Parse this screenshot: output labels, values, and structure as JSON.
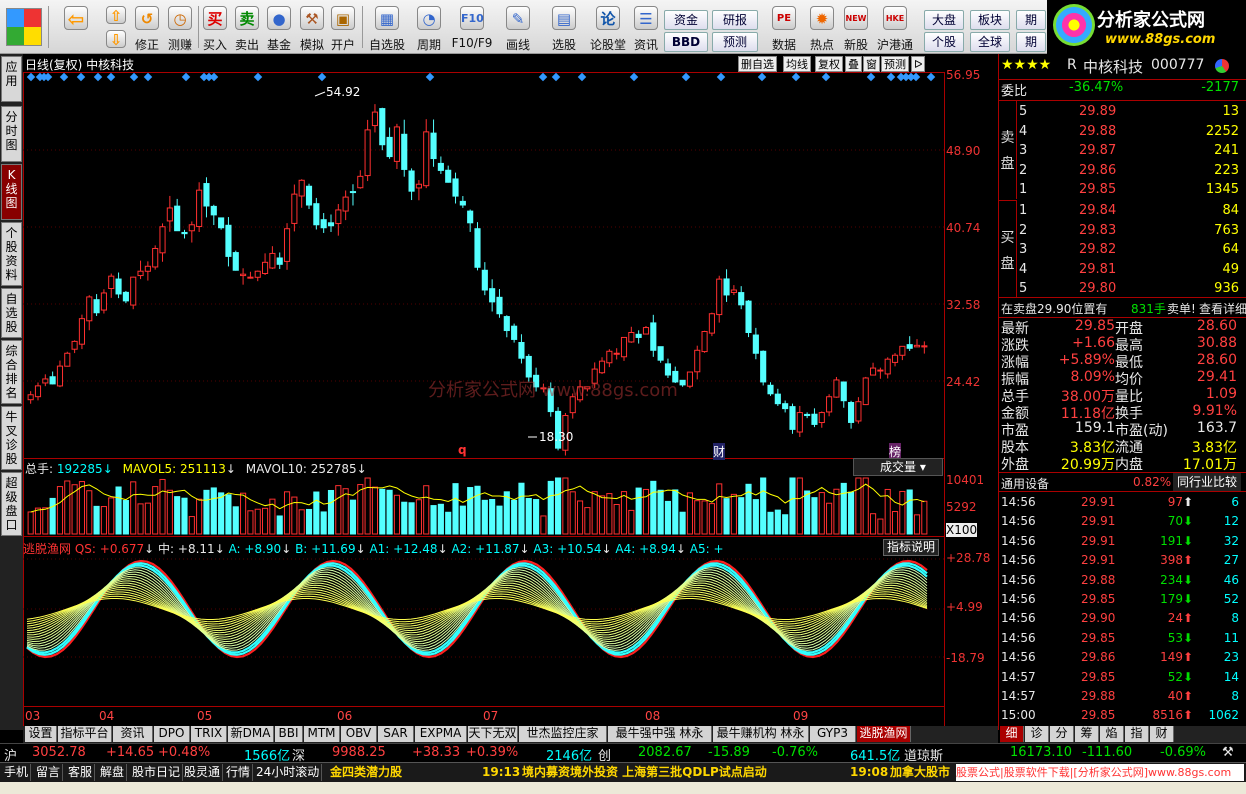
{
  "toolbar": {
    "buttons": [
      {
        "id": "back",
        "label": "",
        "icon": "back-arrow-icon"
      },
      {
        "id": "revise",
        "label": "修正",
        "icon": "revise-icon"
      },
      {
        "id": "test",
        "label": "测赚",
        "icon": "clock-icon"
      },
      {
        "id": "buy",
        "label": "买入",
        "icon": "buy-icon",
        "glyph": "买"
      },
      {
        "id": "sell",
        "label": "卖出",
        "icon": "sell-icon",
        "glyph": "卖"
      },
      {
        "id": "fund",
        "label": "基金",
        "icon": "fund-icon"
      },
      {
        "id": "sim",
        "label": "模拟",
        "icon": "hammer-icon"
      },
      {
        "id": "open",
        "label": "开户",
        "icon": "lock-icon"
      },
      {
        "id": "self",
        "label": "自选股",
        "icon": "selfstock-icon"
      },
      {
        "id": "period",
        "label": "周期",
        "icon": "period-icon"
      },
      {
        "id": "f7f9",
        "label": "F10/F9",
        "icon": "f10-icon"
      },
      {
        "id": "draw",
        "label": "画线",
        "icon": "pen-icon"
      },
      {
        "id": "pick",
        "label": "选股",
        "icon": "pick-icon"
      },
      {
        "id": "forum",
        "label": "论股堂",
        "icon": "forum-icon",
        "glyph": "论"
      },
      {
        "id": "info",
        "label": "资讯",
        "icon": "info-icon"
      },
      {
        "id": "data",
        "label": "数据",
        "icon": "pe-icon",
        "glyph": "PE"
      },
      {
        "id": "hot",
        "label": "热点",
        "icon": "hot-icon"
      },
      {
        "id": "newstock",
        "label": "新股",
        "icon": "newstock-icon",
        "glyph": "NEW"
      },
      {
        "id": "hk",
        "label": "沪港通",
        "icon": "hk-icon",
        "glyph": "HKE"
      }
    ],
    "small": {
      "capital": "资金",
      "bbd": "BBD",
      "research": "研报",
      "forecast": "预测",
      "market": "大盘",
      "sector": "板块",
      "stock": "个股",
      "global": "全球",
      "period_short": "期"
    }
  },
  "logo": {
    "title": "分析家公式网",
    "url": "www.88gs.com"
  },
  "left_tabs": [
    "应用",
    "分时图",
    "K线图",
    "个股资料",
    "自选股",
    "综合排名",
    "牛叉诊股",
    "超级盘口"
  ],
  "chart": {
    "header": "日线(复权)  中核科技",
    "tool_buttons": [
      "删自选",
      "均线",
      "复权",
      "叠",
      "窗",
      "预测",
      "ᐅ"
    ],
    "price_axis": [
      "56.95",
      "48.90",
      "40.74",
      "32.58",
      "24.42"
    ],
    "high_label": "54.92",
    "low_label": "18.30",
    "watermark": "分析家公式网   www.88gs.com",
    "markers": [
      "q",
      "财",
      "榜"
    ],
    "volume": {
      "label_total": "总手:",
      "total": "192285",
      "mavol5_label": "MAVOL5:",
      "mavol5": "251113",
      "mavol10_label": "MAVOL10:",
      "mavol10": "252785",
      "dropdown": "成交量",
      "axis": [
        "10401",
        "5292",
        "X100"
      ]
    },
    "indicator": {
      "name": "逃脱渔网",
      "qs": "QS: +0.677",
      "mid": "中: +8.11",
      "a": "A: +8.90",
      "b": "B: +11.69",
      "a1": "A1: +12.48",
      "a2": "A2: +11.87",
      "a3": "A3: +10.54",
      "a4": "A4: +8.94",
      "a5": "A5: +",
      "explain": "指标说明",
      "axis": [
        "+28.78",
        "+4.99",
        "-18.79"
      ]
    },
    "months": [
      "03",
      "04",
      "05",
      "06",
      "07",
      "08",
      "09"
    ]
  },
  "chart_data": {
    "type": "candlestick",
    "title": "日线(复权) 中核科技",
    "ylim": [
      18.3,
      56.95
    ],
    "closes": [
      24.9,
      25.8,
      26.5,
      26.0,
      27.8,
      29.1,
      30.3,
      32.6,
      34.8,
      33.2,
      35.2,
      36.9,
      35.1,
      34.4,
      36.8,
      37.4,
      37.9,
      39.7,
      41.9,
      43.8,
      41.5,
      41.2,
      42.1,
      45.6,
      44.0,
      43.1,
      41.8,
      38.9,
      37.5,
      37.1,
      36.8,
      37.4,
      38.3,
      39.2,
      38.1,
      41.7,
      45.2,
      46.6,
      44.1,
      42.1,
      41.8,
      42.0,
      43.6,
      44.9,
      45.4,
      47.0,
      51.7,
      53.5,
      50.2,
      49.0,
      52.0,
      47.7,
      45.5,
      46.2,
      51.5,
      48.8,
      47.6,
      46.4,
      45.0,
      44.1,
      42.3,
      37.8,
      35.5,
      34.3,
      33.1,
      31.4,
      30.5,
      28.6,
      26.7,
      25.7,
      25.6,
      23.2,
      19.5,
      22.8,
      24.7,
      25.7,
      25.7,
      27.5,
      28.3,
      29.3,
      29.1,
      30.7,
      31.2,
      30.7,
      31.7,
      29.4,
      28.4,
      26.9,
      26.2,
      25.9,
      27.2,
      29.4,
      31.3,
      33.1,
      36.6,
      35.0,
      35.5,
      34.0,
      31.2,
      29.1,
      26.2,
      25.0,
      24.0,
      23.5,
      21.4,
      23.1,
      22.8,
      21.9,
      23.1,
      24.7,
      26.4,
      24.3,
      22.1,
      24.2,
      26.6,
      27.6,
      27.4,
      28.5,
      28.9,
      29.8,
      29.6,
      29.9,
      29.85
    ],
    "high": 54.92,
    "low": 18.3
  },
  "quote": {
    "stars": "★★★★",
    "r": "R",
    "name": "中核科技",
    "code": "000777",
    "weibi_label": "委比",
    "weibi": "-36.47%",
    "weicha": "-2177",
    "sell_label": [
      "卖",
      "盘"
    ],
    "buy_label": [
      "买",
      "盘"
    ],
    "asks": [
      {
        "n": "5",
        "p": "29.89",
        "v": "13"
      },
      {
        "n": "4",
        "p": "29.88",
        "v": "2252"
      },
      {
        "n": "3",
        "p": "29.87",
        "v": "241"
      },
      {
        "n": "2",
        "p": "29.86",
        "v": "223"
      },
      {
        "n": "1",
        "p": "29.85",
        "v": "1345"
      }
    ],
    "bids": [
      {
        "n": "1",
        "p": "29.84",
        "v": "84"
      },
      {
        "n": "2",
        "p": "29.83",
        "v": "763"
      },
      {
        "n": "3",
        "p": "29.82",
        "v": "64"
      },
      {
        "n": "4",
        "p": "29.81",
        "v": "49"
      },
      {
        "n": "5",
        "p": "29.80",
        "v": "936"
      }
    ],
    "notice": {
      "a": "在卖盘29.90位置有",
      "b": "831手",
      "c": "卖单!",
      "d": "查看详细"
    },
    "stats": [
      {
        "l1": "最新",
        "v1": "29.85",
        "l2": "开盘",
        "v2": "28.60"
      },
      {
        "l1": "涨跌",
        "v1": "+1.66",
        "l2": "最高",
        "v2": "30.88"
      },
      {
        "l1": "涨幅",
        "v1": "+5.89%",
        "l2": "最低",
        "v2": "28.60"
      },
      {
        "l1": "振幅",
        "v1": "8.09%",
        "l2": "均价",
        "v2": "29.41"
      },
      {
        "l1": "总手",
        "v1": "38.00万",
        "l2": "量比",
        "v2": "1.09"
      },
      {
        "l1": "金额",
        "v1": "11.18亿",
        "l2": "换手",
        "v2": "9.91%"
      },
      {
        "l1": "市盈",
        "v1": "159.1",
        "l2": "市盈(动)",
        "v2": "163.7"
      },
      {
        "l1": "股本",
        "v1": "3.83亿",
        "l2": "流通",
        "v2": "3.83亿"
      },
      {
        "l1": "外盘",
        "v1": "20.99万",
        "l2": "内盘",
        "v2": "17.01万"
      }
    ],
    "device": {
      "label": "通用设备",
      "pct": "0.82%",
      "compare": "同行业比较"
    },
    "ticks": [
      {
        "t": "14:56",
        "p": "29.91",
        "v": "97",
        "d": "up",
        "n": "6"
      },
      {
        "t": "14:56",
        "p": "29.91",
        "v": "70",
        "d": "dn",
        "n": "12"
      },
      {
        "t": "14:56",
        "p": "29.91",
        "v": "191",
        "d": "dn",
        "n": "32"
      },
      {
        "t": "14:56",
        "p": "29.91",
        "v": "398",
        "d": "up",
        "n": "27"
      },
      {
        "t": "14:56",
        "p": "29.88",
        "v": "234",
        "d": "dn",
        "n": "46"
      },
      {
        "t": "14:56",
        "p": "29.85",
        "v": "179",
        "d": "dn",
        "n": "52"
      },
      {
        "t": "14:56",
        "p": "29.90",
        "v": "24",
        "d": "up",
        "n": "8"
      },
      {
        "t": "14:56",
        "p": "29.85",
        "v": "53",
        "d": "dn",
        "n": "11"
      },
      {
        "t": "14:56",
        "p": "29.86",
        "v": "149",
        "d": "up",
        "n": "23"
      },
      {
        "t": "14:57",
        "p": "29.85",
        "v": "52",
        "d": "dn",
        "n": "14"
      },
      {
        "t": "14:57",
        "p": "29.88",
        "v": "40",
        "d": "up",
        "n": "8"
      },
      {
        "t": "15:00",
        "p": "29.85",
        "v": "8516",
        "d": "up",
        "n": "1062"
      }
    ]
  },
  "bottom_tabs": [
    "设置",
    "指标平台",
    "资讯",
    "DPO",
    "TRIX",
    "新DMA",
    "BBI",
    "MTM",
    "OBV",
    "SAR",
    "EXPMA",
    "天下无双",
    "世杰监控庄家",
    "最牛强中强 林永",
    "最牛赚机构 林永",
    "GYP3",
    "逃脱渔网"
  ],
  "right_tabs": [
    "细",
    "诊",
    "分",
    "筹",
    "焰",
    "指",
    "财"
  ],
  "index_bar": {
    "sh": "沪",
    "sh_v": "3052.78",
    "sh_c": "+14.65",
    "sh_p": "+0.48%",
    "sh_amt": "1566亿",
    "sz": "深",
    "sz_v": "9988.25",
    "sz_c": "+38.33",
    "sz_p": "+0.39%",
    "sz_amt": "2146亿",
    "cy": "创",
    "cy_v": "2082.67",
    "cy_c": "-15.89",
    "cy_p": "-0.76%",
    "cy_amt": "641.5亿",
    "hk": "道琼斯",
    "hk_v": "16173.10",
    "hk_c": "-111.60",
    "hk_p": "-0.69%"
  },
  "status": {
    "items": [
      "手机",
      "留言",
      "客服",
      "解盘",
      "股市日记",
      "股灵通",
      "行情",
      "24小时滚动"
    ],
    "news1": "金四类潜力股",
    "time1": "19:13",
    "news2": "境内募资境外投资 上海第三批QDLP试点启动",
    "time2": "19:08",
    "news3": "加拿大股市",
    "ad": "股票公式|股票软件下载|[分析家公式网]www.88gs.com"
  }
}
